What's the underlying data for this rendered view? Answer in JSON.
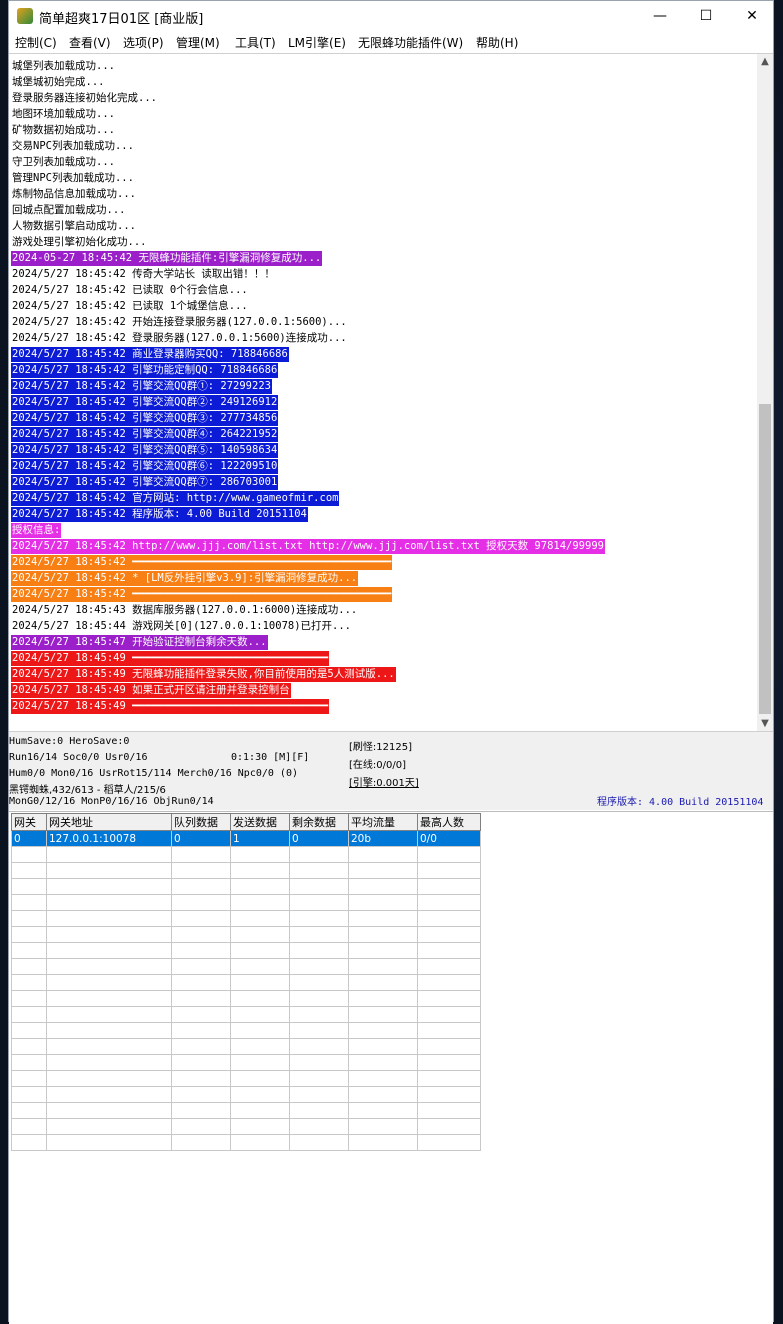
{
  "window": {
    "title": "简单超爽17日01区 [商业版]",
    "minimize": "—",
    "maximize": "☐",
    "close": "✕"
  },
  "menu": [
    "控制(C)",
    "查看(V)",
    "选项(P)",
    "管理(M)",
    "工具(T)",
    "LM引擎(E)",
    "无限蜂功能插件(W)",
    "帮助(H)"
  ],
  "log": [
    {
      "text": "城堡列表加载成功...",
      "style": ""
    },
    {
      "text": "城堡城初始完成...",
      "style": ""
    },
    {
      "text": "登录服务器连接初始化完成...",
      "style": ""
    },
    {
      "text": "地图环境加载成功...",
      "style": ""
    },
    {
      "text": "矿物数据初始成功...",
      "style": ""
    },
    {
      "text": "交易NPC列表加载成功...",
      "style": ""
    },
    {
      "text": "守卫列表加载成功...",
      "style": ""
    },
    {
      "text": "管理NPC列表加载成功...",
      "style": ""
    },
    {
      "text": "炼制物品信息加载成功...",
      "style": ""
    },
    {
      "text": "回城点配置加载成功...",
      "style": ""
    },
    {
      "text": "人物数据引擎启动成功...",
      "style": ""
    },
    {
      "text": "游戏处理引擎初始化成功...",
      "style": ""
    },
    {
      "text": "2024-05-27 18:45:42 无限蜂功能插件:引擎漏洞修复成功...",
      "style": "purple"
    },
    {
      "text": "2024/5/27 18:45:42 传奇大学站长 读取出错！！！",
      "style": ""
    },
    {
      "text": "2024/5/27 18:45:42 已读取 0个行会信息...",
      "style": ""
    },
    {
      "text": "2024/5/27 18:45:42 已读取 1个城堡信息...",
      "style": ""
    },
    {
      "text": "2024/5/27 18:45:42 开始连接登录服务器(127.0.0.1:5600)...",
      "style": ""
    },
    {
      "text": "2024/5/27 18:45:42 登录服务器(127.0.0.1:5600)连接成功...",
      "style": ""
    },
    {
      "text": "2024/5/27 18:45:42 商业登录器购买QQ: 718846686",
      "style": "blue"
    },
    {
      "text": "2024/5/27 18:45:42 引擎功能定制QQ: 718846686",
      "style": "blue"
    },
    {
      "text": "2024/5/27 18:45:42 引擎交流QQ群①: 27299223",
      "style": "blue"
    },
    {
      "text": "2024/5/27 18:45:42 引擎交流QQ群②: 249126912",
      "style": "blue"
    },
    {
      "text": "2024/5/27 18:45:42 引擎交流QQ群③: 277734856",
      "style": "blue"
    },
    {
      "text": "2024/5/27 18:45:42 引擎交流QQ群④: 264221952",
      "style": "blue"
    },
    {
      "text": "2024/5/27 18:45:42 引擎交流QQ群⑤: 140598634",
      "style": "blue"
    },
    {
      "text": "2024/5/27 18:45:42 引擎交流QQ群⑥: 122209510",
      "style": "blue"
    },
    {
      "text": "2024/5/27 18:45:42 引擎交流QQ群⑦: 286703001",
      "style": "blue"
    },
    {
      "text": "2024/5/27 18:45:42 官方网站: http://www.gameofmir.com",
      "style": "blue"
    },
    {
      "text": "2024/5/27 18:45:42 程序版本: 4.00 Build 20151104",
      "style": "blue"
    },
    {
      "text": "授权信息:",
      "style": "magenta"
    },
    {
      "text": "2024/5/27 18:45:42 http://www.jjj.com/list.txt http://www.jjj.com/list.txt 授权天数 97814/99999",
      "style": "magenta"
    },
    {
      "text": "2024/5/27 18:45:42 ━━━━━━━━━━━━━━━━━━━━━━━━━━━━━━━━━━━━━━━━━",
      "style": "orange"
    },
    {
      "text": "2024/5/27 18:45:42 * [LM反外挂引擎v3.9]:引擎漏洞修复成功...",
      "style": "orange"
    },
    {
      "text": "2024/5/27 18:45:42 ━━━━━━━━━━━━━━━━━━━━━━━━━━━━━━━━━━━━━━━━━",
      "style": "orange"
    },
    {
      "text": "2024/5/27 18:45:43 数据库服务器(127.0.0.1:6000)连接成功...",
      "style": ""
    },
    {
      "text": "2024/5/27 18:45:44 游戏网关[0](127.0.0.1:10078)已打开...",
      "style": ""
    },
    {
      "text": "2024/5/27 18:45:47 开始验证控制台剩余天数...",
      "style": "purple"
    },
    {
      "text": "2024/5/27 18:45:49 ━━━━━━━━━━━━━━━━━━━━━━━━━━━━━━━",
      "style": "red"
    },
    {
      "text": "2024/5/27 18:45:49 无限蜂功能插件登录失败,你目前使用的是5人测试版...",
      "style": "red"
    },
    {
      "text": "2024/5/27 18:45:49 如果正式开区请注册并登录控制台",
      "style": "red"
    },
    {
      "text": "2024/5/27 18:45:49 ━━━━━━━━━━━━━━━━━━━━━━━━━━━━━━━",
      "style": "red"
    }
  ],
  "status": {
    "line1": "HumSave:0 HeroSave:0",
    "line2a": "Run16/14 Soc0/0 Usr0/16",
    "line2b": "0:1:30 [M][F]",
    "line3": "Hum0/0 Mon0/16 UsrRot15/114 Merch0/16 Npc0/0 (0)",
    "line4": "黑锷蜘蛛,432/613 - 稻草人/215/6",
    "line5": "MonG0/12/16 MonP0/16/16 ObjRun0/14",
    "refresh": "[刷怪:12125]",
    "online": "[在线:0/0/0]",
    "engine": "[引擎:0.001天]",
    "version": "程序版本: 4.00 Build 20151104"
  },
  "gateway_table": {
    "headers": [
      "网关",
      "网关地址",
      "队列数据",
      "发送数据",
      "剩余数据",
      "平均流量",
      "最高人数"
    ],
    "rows": [
      [
        "0",
        "127.0.0.1:10078",
        "0",
        "1",
        "0",
        "20b",
        "0/0"
      ]
    ]
  },
  "icons": [
    "app-icon",
    "scroll-up-icon",
    "scroll-down-icon"
  ]
}
